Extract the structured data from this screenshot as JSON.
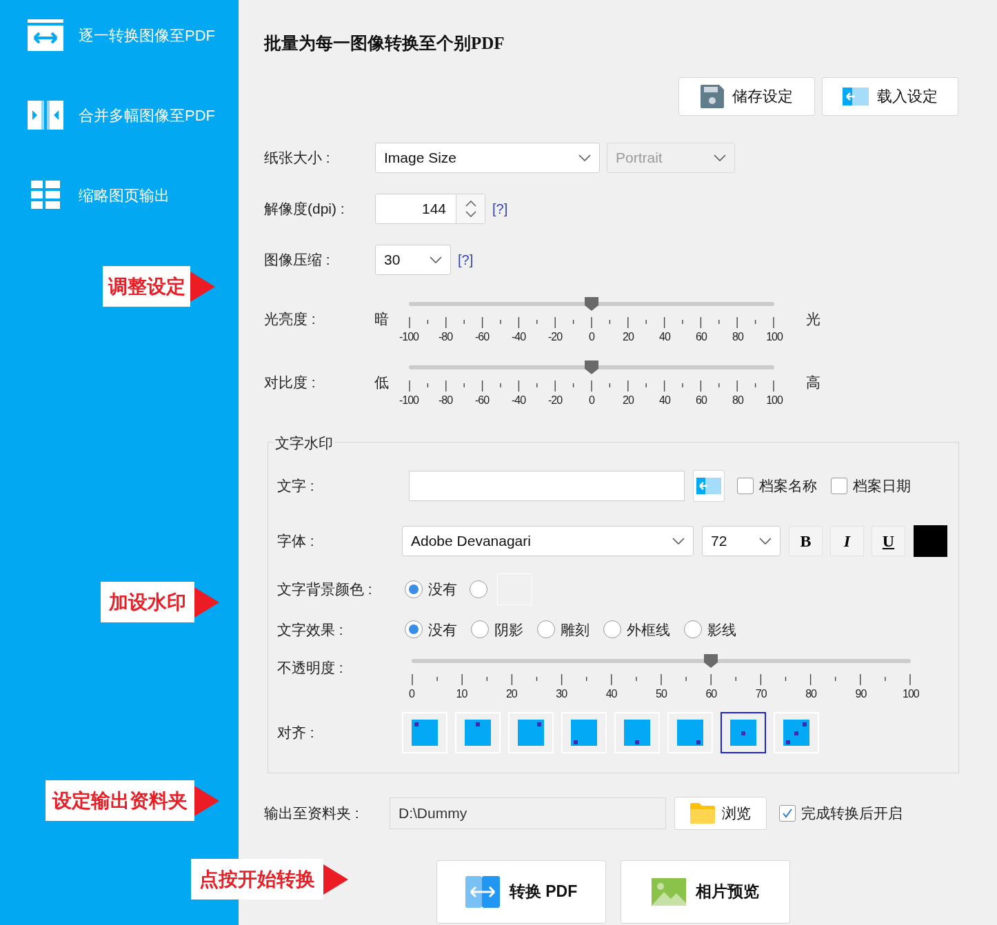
{
  "sidebar": {
    "items": [
      {
        "label": "逐一转换图像至PDF",
        "kind": "single"
      },
      {
        "label": "合并多幅图像至PDF",
        "kind": "merge"
      },
      {
        "label": "缩略图页输出",
        "kind": "thumbnail"
      }
    ]
  },
  "callouts": [
    "调整设定",
    "加设水印",
    "设定输出资料夹",
    "点按开始转换"
  ],
  "title": "批量为每一图像转换至个别PDF",
  "settings_buttons": [
    {
      "label": "储存设定",
      "kind": "save"
    },
    {
      "label": "载入设定",
      "kind": "load"
    }
  ],
  "paper_size": {
    "label": "纸张大小 :",
    "value": "Image Size",
    "orientation": {
      "value": "Portrait",
      "disabled": true
    }
  },
  "resolution": {
    "label": "解像度(dpi) :",
    "value": "144",
    "help": "[?]"
  },
  "compression": {
    "label": "图像压缩 :",
    "value": "30",
    "help": "[?]"
  },
  "brightness": {
    "label": "光亮度 :",
    "low": "暗",
    "high": "光",
    "level": 0.5,
    "ticks": [
      "-100",
      "-80",
      "-60",
      "-40",
      "-20",
      "0",
      "20",
      "40",
      "60",
      "80",
      "100"
    ]
  },
  "contrast": {
    "label": "对比度 :",
    "low": "低",
    "high": "高",
    "level": 0.5,
    "ticks": [
      "-100",
      "-80",
      "-60",
      "-40",
      "-20",
      "0",
      "20",
      "40",
      "60",
      "80",
      "100"
    ]
  },
  "watermark": {
    "title": "文字水印",
    "text": {
      "label": "文字 :",
      "checkboxes": [
        {
          "label": "档案名称",
          "checked": false
        },
        {
          "label": "档案日期",
          "checked": false
        }
      ]
    },
    "font": {
      "label": "字体 :",
      "value": "Adobe Devanagari",
      "size": "72",
      "styles": [
        {
          "label": "B",
          "kind": "bold"
        },
        {
          "label": "I",
          "kind": "italic"
        },
        {
          "label": "U",
          "kind": "underline"
        }
      ],
      "color": "#000000"
    },
    "background": {
      "label": "文字背景颜色 :",
      "options": [
        {
          "kind": "none",
          "label": "没有",
          "selected": true
        },
        {
          "kind": "color",
          "selected": false
        }
      ]
    },
    "effect": {
      "label": "文字效果 :",
      "options": [
        {
          "label": "没有",
          "selected": true
        },
        {
          "label": "阴影",
          "selected": false
        },
        {
          "label": "雕刻",
          "selected": false
        },
        {
          "label": "外框线",
          "selected": false
        },
        {
          "label": "影线",
          "selected": false
        }
      ]
    },
    "opacity": {
      "label": "不透明度 :",
      "level": 0.6,
      "ticks": [
        "0",
        "10",
        "20",
        "30",
        "40",
        "50",
        "60",
        "70",
        "80",
        "90",
        "100"
      ]
    },
    "alignment": {
      "label": "对齐 :",
      "options": [
        {
          "kind": "top-left",
          "selected": false
        },
        {
          "kind": "top-center",
          "selected": false
        },
        {
          "kind": "top-right",
          "selected": false
        },
        {
          "kind": "bottom-left",
          "selected": false
        },
        {
          "kind": "bottom-center",
          "selected": false
        },
        {
          "kind": "bottom-right",
          "selected": false
        },
        {
          "kind": "center",
          "selected": true
        },
        {
          "kind": "diagonal",
          "selected": false
        }
      ]
    }
  },
  "output": {
    "label": "输出至资料夹 :",
    "value": "D:\\Dummy",
    "browse": "浏览",
    "open_after": {
      "label": "完成转换后开启",
      "checked": true
    }
  },
  "actions": [
    {
      "label": "转换 PDF",
      "kind": "convert"
    },
    {
      "label": "相片预览",
      "kind": "preview"
    }
  ]
}
